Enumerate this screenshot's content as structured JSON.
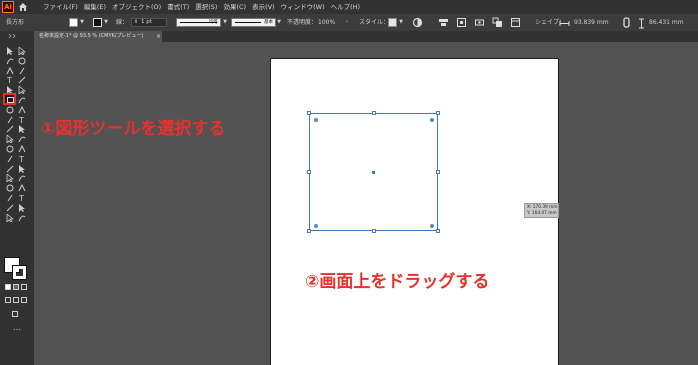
{
  "app": {
    "logo_text": "Ai"
  },
  "menu": [
    "ファイル(F)",
    "編集(E)",
    "オブジェクト(O)",
    "書式(T)",
    "選択(S)",
    "効果(C)",
    "表示(V)",
    "ウィンドウ(W)",
    "ヘルプ(H)"
  ],
  "control_bar": {
    "tool_name": "長方形",
    "stroke_label": "線：",
    "stroke_weight": "1 pt",
    "stroke_profile": "均等",
    "brush_definition": "基本",
    "opacity_label": "不透明度：",
    "opacity_value": "100%",
    "style_label": "スタイル：",
    "shape_label": "シェイプ：",
    "width_value": "93.839 mm",
    "height_value": "86.431 mm"
  },
  "document_tab": {
    "label": "名称未設定-1* @ 93.5 % (CMYK/プレビュー)",
    "close": "×"
  },
  "tooltip": {
    "x": "X: 170.39 mm",
    "y": "Y: 164.07 mm"
  },
  "annotations": {
    "step1": "①図形ツールを選択する",
    "step2": "②画面上をドラッグする"
  },
  "toolbar": {
    "more": "…"
  },
  "colors": {
    "accent": "#e8302c",
    "selection": "#4578be",
    "ui_dark": "#323232",
    "canvas": "#535353"
  }
}
